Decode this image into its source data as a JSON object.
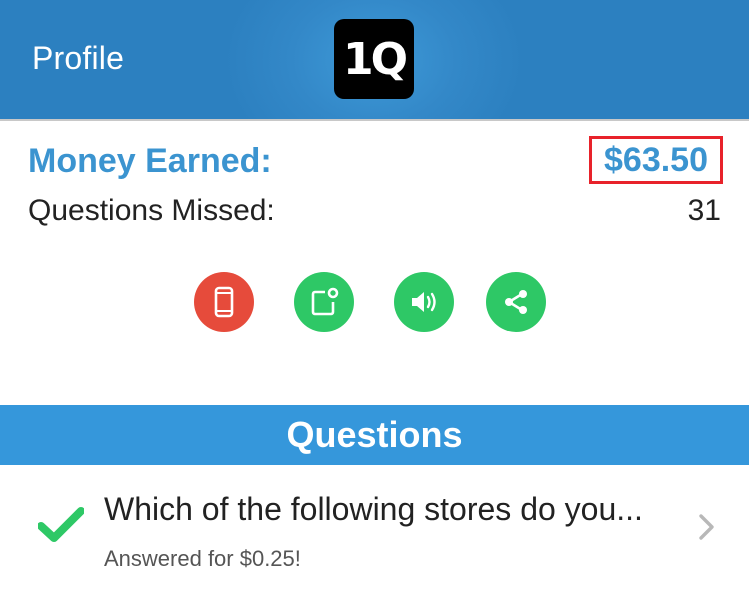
{
  "header": {
    "title": "Profile",
    "logo_text": "1Q"
  },
  "stats": {
    "money_label": "Money Earned:",
    "money_value": "$63.50",
    "missed_label": "Questions Missed:",
    "missed_value": "31"
  },
  "actions": [
    {
      "icon": "phone-icon",
      "color": "#e64b3b"
    },
    {
      "icon": "notification-icon",
      "color": "#2ec866"
    },
    {
      "icon": "speaker-icon",
      "color": "#2ec866"
    },
    {
      "icon": "share-icon",
      "color": "#2ec866"
    }
  ],
  "questions": {
    "heading": "Questions",
    "items": [
      {
        "text": "Which of the following stores do you...",
        "status": "Answered for $0.25!"
      }
    ]
  }
}
